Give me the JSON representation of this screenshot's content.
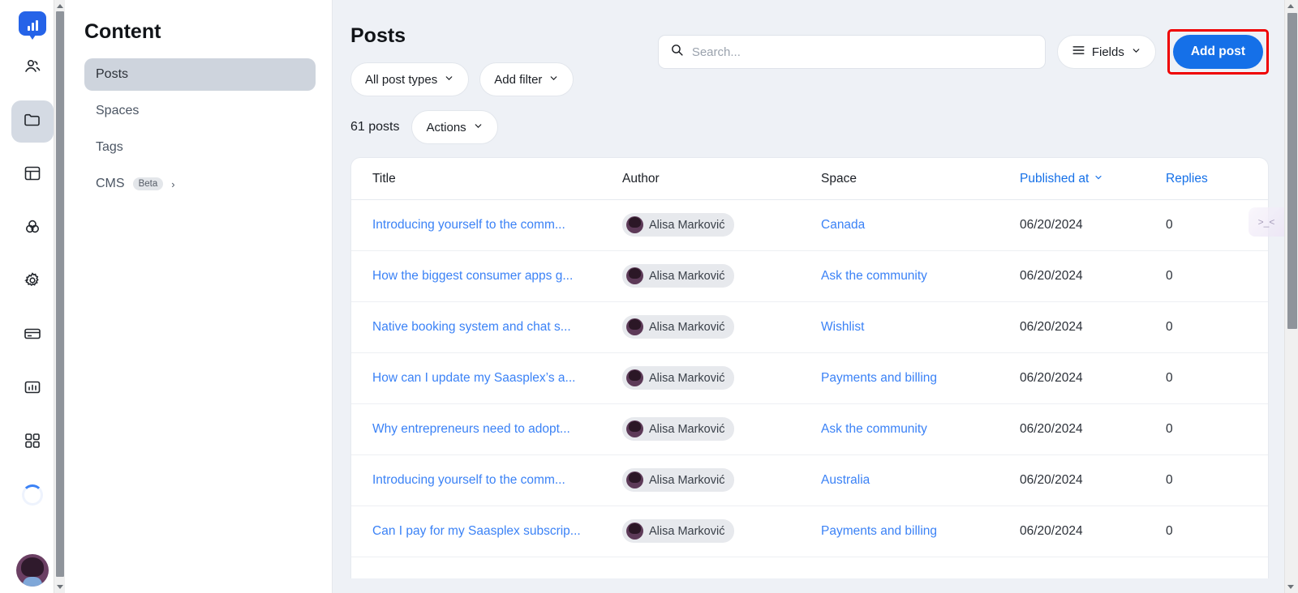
{
  "rail": {
    "logo": "analytics-bubble-logo",
    "items": [
      {
        "icon": "people-icon",
        "active": false
      },
      {
        "icon": "folder-icon",
        "active": true
      },
      {
        "icon": "layout-icon",
        "active": false
      },
      {
        "icon": "circles-icon",
        "active": false
      },
      {
        "icon": "gear-icon",
        "active": false
      },
      {
        "icon": "credit-card-icon",
        "active": false
      },
      {
        "icon": "bar-chart-icon",
        "active": false
      },
      {
        "icon": "grid-icon",
        "active": false
      }
    ],
    "loading": "loading-spinner",
    "avatar": "user-avatar"
  },
  "sidebar": {
    "title": "Content",
    "items": [
      {
        "label": "Posts",
        "active": true,
        "badge": "",
        "chevron": ""
      },
      {
        "label": "Spaces",
        "active": false,
        "badge": "",
        "chevron": ""
      },
      {
        "label": "Tags",
        "active": false,
        "badge": "",
        "chevron": ""
      },
      {
        "label": "CMS",
        "active": false,
        "badge": "Beta",
        "chevron": "›"
      }
    ]
  },
  "main": {
    "page_title": "Posts",
    "search": {
      "value": "",
      "placeholder": "Search..."
    },
    "fields_label": "Fields",
    "add_post_label": "Add post",
    "filters": {
      "post_types_label": "All post types",
      "add_filter_label": "Add filter"
    },
    "count_label": "61 posts",
    "actions_label": "Actions",
    "float_tab_label": ">_<"
  },
  "table": {
    "columns": [
      {
        "label": "Title",
        "link": false
      },
      {
        "label": "Author",
        "link": false
      },
      {
        "label": "Space",
        "link": false
      },
      {
        "label": "Published at",
        "link": true,
        "sorted": true
      },
      {
        "label": "Replies",
        "link": true
      }
    ],
    "rows": [
      {
        "title": "Introducing yourself to the comm...",
        "author": "Alisa Marković",
        "space": "Canada",
        "published_at": "06/20/2024",
        "replies": "0"
      },
      {
        "title": "How the biggest consumer apps g...",
        "author": "Alisa Marković",
        "space": "Ask the community",
        "published_at": "06/20/2024",
        "replies": "0"
      },
      {
        "title": "Native booking system and chat s...",
        "author": "Alisa Marković",
        "space": "Wishlist",
        "published_at": "06/20/2024",
        "replies": "0"
      },
      {
        "title": "How can I update my Saasplex’s a...",
        "author": "Alisa Marković",
        "space": "Payments and billing",
        "published_at": "06/20/2024",
        "replies": "0"
      },
      {
        "title": "Why entrepreneurs need to adopt...",
        "author": "Alisa Marković",
        "space": "Ask the community",
        "published_at": "06/20/2024",
        "replies": "0"
      },
      {
        "title": "Introducing yourself to the comm...",
        "author": "Alisa Marković",
        "space": "Australia",
        "published_at": "06/20/2024",
        "replies": "0"
      },
      {
        "title": "Can I pay for my Saasplex subscrip...",
        "author": "Alisa Marković",
        "space": "Payments and billing",
        "published_at": "06/20/2024",
        "replies": "0"
      }
    ]
  },
  "colors": {
    "accent_blue": "#1570e8",
    "link_blue": "#3b82f6",
    "page_bg": "#eef1f6",
    "highlight_red": "#ef0000",
    "active_nav": "#ced4dd"
  }
}
